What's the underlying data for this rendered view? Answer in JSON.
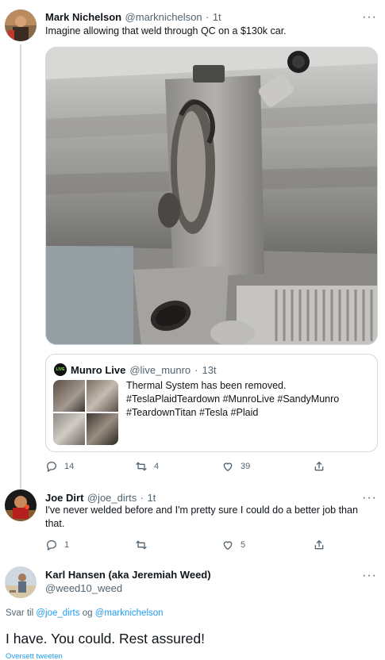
{
  "tweet1": {
    "name": "Mark Nichelson",
    "handle": "@marknichelson",
    "dot": "·",
    "time": "1t",
    "text": "Imagine allowing that weld through QC on a $130k car.",
    "quote": {
      "name": "Munro Live",
      "handle": "@live_munro",
      "dot": "·",
      "time": "13t",
      "badge": "LIVE",
      "text_line1": "Thermal System has been removed.",
      "text_line2": "#TeslaPlaidTeardown #MunroLive #SandyMunro",
      "text_line3": "#TeardownTitan #Tesla #Plaid"
    },
    "actions": {
      "replies": "14",
      "retweets": "4",
      "likes": "39"
    }
  },
  "tweet2": {
    "name": "Joe Dirt",
    "handle": "@joe_dirts",
    "dot": "·",
    "time": "1t",
    "text_line1": "I've never welded before and I'm pretty sure I could do a better job than",
    "text_line2": "that.",
    "actions": {
      "replies": "1",
      "retweets": "",
      "likes": "5"
    }
  },
  "tweet3": {
    "name": "Karl Hansen (aka Jeremiah Weed)",
    "handle": "@weed10_weed",
    "reply_prefix": "Svar til",
    "reply_user1": "@joe_dirts",
    "reply_and": "og",
    "reply_user2": "@marknichelson",
    "text": "I have. You could. Rest assured!",
    "translate": "Oversett tweeten"
  },
  "more_label": "···",
  "colors": {
    "accent": "#1d9bf0",
    "secondary_text": "#536471",
    "border": "#cfd9de"
  }
}
